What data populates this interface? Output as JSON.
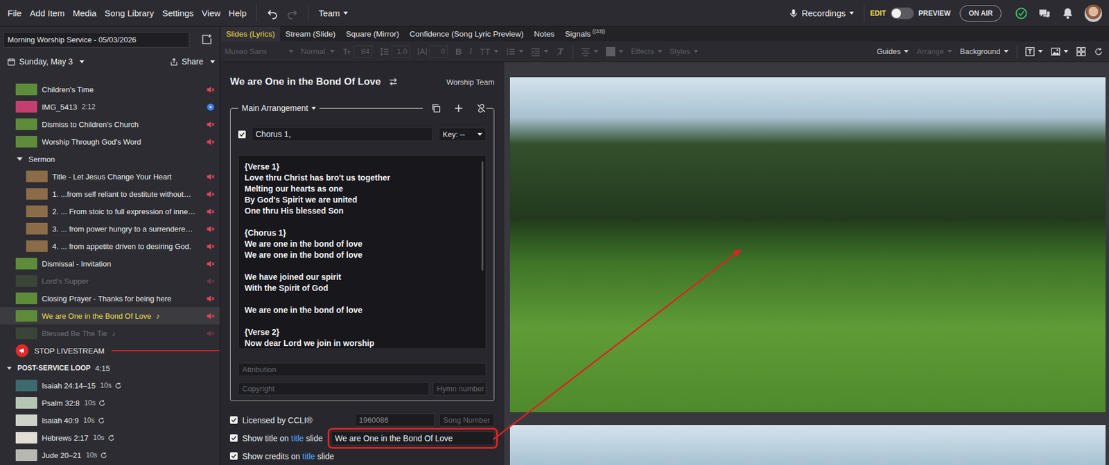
{
  "menubar": {
    "menu": [
      "File",
      "Add Item",
      "Media",
      "Song Library",
      "Settings",
      "View",
      "Help"
    ],
    "undo_enabled": true,
    "redo_enabled": false,
    "team": "Team",
    "recordings": "Recordings",
    "mode_toggle": {
      "left": "EDIT",
      "right": "PREVIEW",
      "on": false
    },
    "on_air": "ON AIR",
    "connected": true
  },
  "sidebar": {
    "plan_title": "Morning Worship Service - 05/03/2026",
    "date": "Sunday, May 3",
    "share": "Share",
    "items": [
      {
        "label": "Children's Time",
        "kind": "slide",
        "depth": 0,
        "color": "#5e8c3a",
        "muted": true,
        "disabled": false,
        "selected": false
      },
      {
        "label": "IMG_5413",
        "kind": "video",
        "depth": 0,
        "color": "#c23f6f",
        "duration": "2:12",
        "muted": false,
        "disabled": false,
        "selected": false
      },
      {
        "label": "Dismiss to Children's Church",
        "kind": "slide",
        "depth": 0,
        "color": "#5e8c3a",
        "muted": true,
        "disabled": false,
        "selected": false
      },
      {
        "label": "Worship Through God's Word",
        "kind": "slide",
        "depth": 0,
        "color": "#5e8c3a",
        "muted": true,
        "disabled": false,
        "selected": false
      },
      {
        "label": "Sermon",
        "kind": "group",
        "depth": 0,
        "expanded": true,
        "muted": false,
        "disabled": false,
        "selected": false
      },
      {
        "label": "Title - Let Jesus Change Your Heart",
        "kind": "slide",
        "depth": 1,
        "color": "#8c6c48",
        "muted": true,
        "disabled": false,
        "selected": false
      },
      {
        "label": "1. ...from self reliant to destitute without…",
        "kind": "slide",
        "depth": 1,
        "color": "#8c6c48",
        "muted": true,
        "disabled": false,
        "selected": false
      },
      {
        "label": "2. ... From stoic to full expression of inne…",
        "kind": "slide",
        "depth": 1,
        "color": "#8c6c48",
        "muted": true,
        "disabled": false,
        "selected": false
      },
      {
        "label": "3. ... from power hungry to a surrendere…",
        "kind": "slide",
        "depth": 1,
        "color": "#8c6c48",
        "muted": true,
        "disabled": false,
        "selected": false
      },
      {
        "label": "4. ... from appetite driven to desiring God.",
        "kind": "slide",
        "depth": 1,
        "color": "#8c6c48",
        "muted": true,
        "disabled": false,
        "selected": false
      },
      {
        "label": "Dismissal - Invitation",
        "kind": "slide",
        "depth": 0,
        "color": "#5e8c3a",
        "muted": true,
        "disabled": false,
        "selected": false
      },
      {
        "label": "Lord's Supper",
        "kind": "slide",
        "depth": 0,
        "color": "#4a5e3c",
        "muted": true,
        "disabled": true,
        "selected": false
      },
      {
        "label": "Closing Prayer - Thanks for being here",
        "kind": "slide",
        "depth": 0,
        "color": "#5e8c3a",
        "muted": true,
        "disabled": false,
        "selected": false
      },
      {
        "label": "We are One in the Bond Of Love",
        "kind": "song",
        "note": "♪",
        "depth": 0,
        "color": "#5e8c3a",
        "muted": true,
        "disabled": false,
        "selected": true
      },
      {
        "label": "Blessed Be The Tie",
        "kind": "song",
        "note": "♪",
        "depth": 0,
        "color": "#4a5e3c",
        "muted": true,
        "disabled": true,
        "selected": false
      },
      {
        "label": "STOP LIVESTREAM",
        "kind": "action",
        "depth": 0,
        "muted": false,
        "disabled": false,
        "selected": false
      }
    ],
    "loop": {
      "title": "POST-SERVICE LOOP",
      "duration": "4:15",
      "expanded": true,
      "items": [
        {
          "label": "Isaiah 24:14–15",
          "duration": "10s",
          "color": "#3c6a6e",
          "loop": true,
          "selected": false
        },
        {
          "label": "Psalm 32:8",
          "duration": "10s",
          "color": "#b7c4b4",
          "loop": true,
          "selected": false
        },
        {
          "label": "Isaiah 40:9",
          "duration": "10s",
          "color": "#cfd2c6",
          "loop": true,
          "selected": false
        },
        {
          "label": "Hebrews 2:17",
          "duration": "10s",
          "color": "#e0ddd4",
          "loop": true,
          "selected": false
        },
        {
          "label": "Jude 20–21",
          "duration": "10s",
          "color": "#b8b8b2",
          "loop": true,
          "selected": false
        }
      ]
    }
  },
  "tabs": [
    {
      "label": "Slides (Lyrics)",
      "selected": true
    },
    {
      "label": "Stream (Slide)",
      "selected": false
    },
    {
      "label": "Square (Mirror)",
      "selected": false
    },
    {
      "label": "Confidence (Song Lyric Preview)",
      "selected": false
    },
    {
      "label": "Notes",
      "selected": false
    },
    {
      "label": "Signals",
      "selected": false,
      "badge": "33"
    }
  ],
  "toolbar": {
    "format_disabled": true,
    "font": "Museo Sans",
    "weight": "Normal",
    "size": "84",
    "line_height": "1.0",
    "spacing": "0",
    "bold": "B",
    "italic": "I",
    "case": "TT",
    "effects": "Effects",
    "styles": "Styles",
    "right": [
      {
        "label": "Guides",
        "disabled": false
      },
      {
        "label": "Arrange",
        "disabled": true
      },
      {
        "label": "Background",
        "disabled": false
      }
    ]
  },
  "editor": {
    "song_title": "We are One in the Bond Of Love",
    "team": "Worship Team",
    "arrangement": "Main Arrangement",
    "arrangement_enabled": true,
    "sequence": "Chorus 1,",
    "key": "Key: --",
    "lyrics": [
      "{Verse 1}",
      "Love thru Christ has bro't us together",
      "Melting our hearts as one",
      "By God's Spirit we are united",
      "One thru His blessed Son",
      "",
      "{Chorus 1}",
      "We are one in the bond of love",
      "We are one in the bond of love",
      "",
      "We have joined our spirit",
      "With the Spirit of God",
      "",
      "We are one in the bond of love",
      "",
      "{Verse 2}",
      "Now dear Lord we join in worship"
    ],
    "attribution_placeholder": "Attribution",
    "copyright_placeholder": "Copyright",
    "hymn_placeholder": "Hymn number",
    "ccli": {
      "label": "Licensed by CCLI®",
      "checked": true,
      "number": "1960086",
      "song_number_placeholder": "Song Number"
    },
    "show_title": {
      "before": "Show title on ",
      "link": "title",
      "after": " slide",
      "checked": true,
      "value": "We are One in the Bond Of Love"
    },
    "show_credits": {
      "before": "Show credits on ",
      "link": "title",
      "after": " slide",
      "checked": true
    }
  },
  "preview": {
    "slides": [
      {
        "selected": false
      },
      {
        "selected": false
      }
    ]
  }
}
